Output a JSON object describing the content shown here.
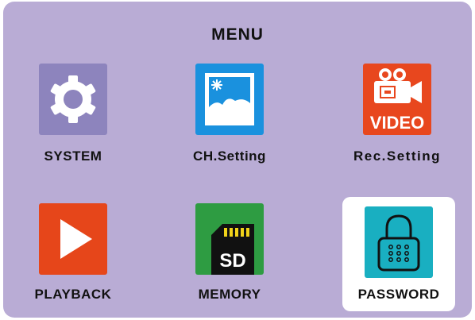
{
  "menu": {
    "title": "MENU"
  },
  "items": [
    {
      "label": "SYSTEM",
      "icon": "gear-icon",
      "color": "#8d84bd",
      "selected": false
    },
    {
      "label": "CH.Setting",
      "icon": "picture-icon",
      "color": "#1a91de",
      "selected": false
    },
    {
      "label": "Rec.Setting",
      "icon": "video-camera-icon",
      "color": "#e8471e",
      "icon_text": "VIDEO",
      "selected": false
    },
    {
      "label": "PLAYBACK",
      "icon": "play-icon",
      "color": "#e6461a",
      "selected": false
    },
    {
      "label": "MEMORY",
      "icon": "sd-card-icon",
      "color": "#2e9c42",
      "icon_text": "SD",
      "selected": false
    },
    {
      "label": "PASSWORD",
      "icon": "padlock-icon",
      "color": "#19afc1",
      "selected": true
    }
  ]
}
